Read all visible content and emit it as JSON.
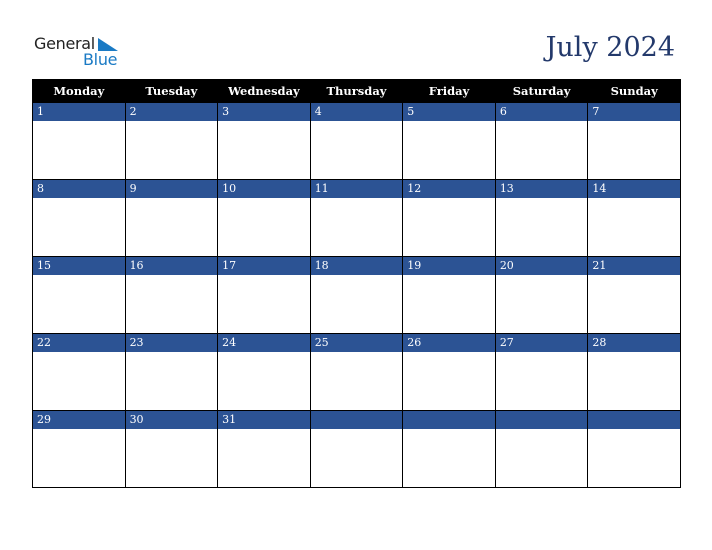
{
  "logo": {
    "line1": "General",
    "line2": "Blue",
    "icon": "triangle-flag-icon",
    "color": "#1a7ac4"
  },
  "title": "July 2024",
  "colors": {
    "header_bg": "#000000",
    "daybar_bg": "#2c5394",
    "title": "#23396b"
  },
  "weekdays": [
    "Monday",
    "Tuesday",
    "Wednesday",
    "Thursday",
    "Friday",
    "Saturday",
    "Sunday"
  ],
  "weeks": [
    [
      "1",
      "2",
      "3",
      "4",
      "5",
      "6",
      "7"
    ],
    [
      "8",
      "9",
      "10",
      "11",
      "12",
      "13",
      "14"
    ],
    [
      "15",
      "16",
      "17",
      "18",
      "19",
      "20",
      "21"
    ],
    [
      "22",
      "23",
      "24",
      "25",
      "26",
      "27",
      "28"
    ],
    [
      "29",
      "30",
      "31",
      "",
      "",
      "",
      ""
    ]
  ]
}
